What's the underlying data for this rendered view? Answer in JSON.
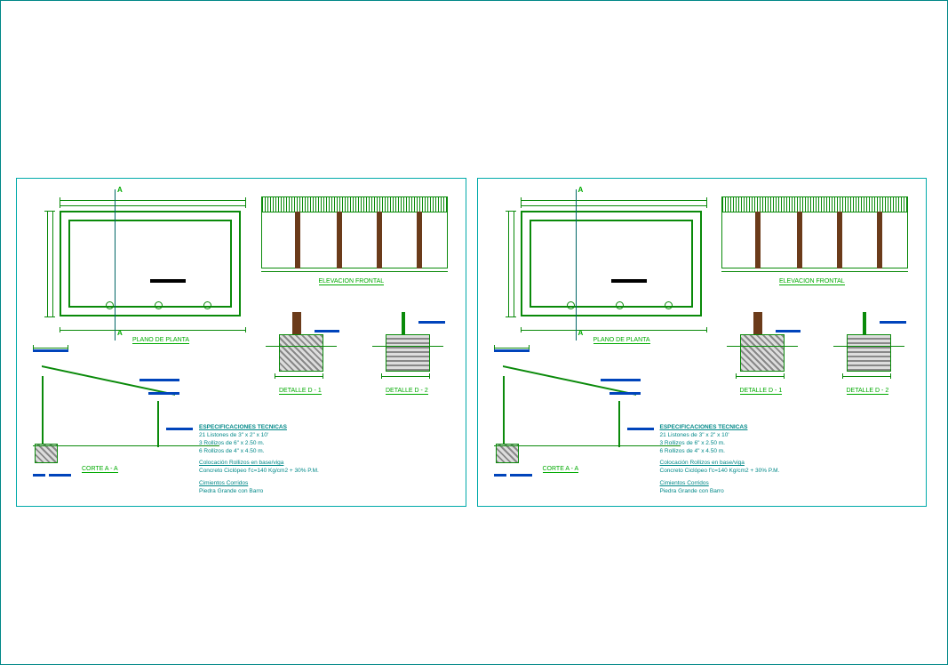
{
  "titles": {
    "plan": "PLANO DE PLANTA",
    "elevation": "ELEVACION FRONTAL",
    "section": "CORTE A - A",
    "detail1": "DETALLE D - 1",
    "detail2": "DETALLE D - 2",
    "cutA_top": "A",
    "cutA_bot": "A"
  },
  "specs": {
    "heading": "ESPECIFICACIONES TECNICAS",
    "line1": "21  Listones de 3\" x 2\" x 10'",
    "line2": "3   Rollizos de 6\" x  2.50 m.",
    "line3": "6   Rollizos de 4\" x  4.50 m.",
    "sub1": "Colocación Rollizos en base/viga",
    "sub1b": "Concreto Ciclópeo f'c=140 Kg/cm2 + 30% P.M.",
    "sub2": "Cimientos Corridos",
    "sub2b": "Piedra Grande con Barro"
  }
}
